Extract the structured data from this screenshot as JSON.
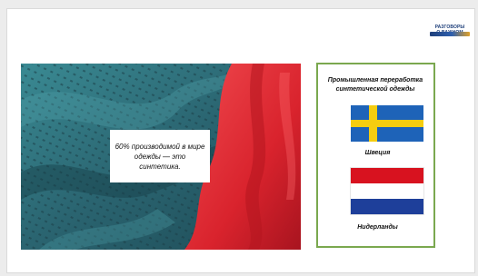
{
  "logo": {
    "text": "РАЗГОВОРЫ\nО ВАЖНОМ"
  },
  "photo": {
    "caption": "60% производимой в мире одежды — это синтетика."
  },
  "panel": {
    "title": "Промышленная переработка синтетической одежды",
    "countries": [
      {
        "name": "Швеция",
        "flag": "sweden-flag"
      },
      {
        "name": "Нидерланды",
        "flag": "netherlands-flag"
      }
    ]
  },
  "colors": {
    "panel_border": "#7aa84f",
    "fabric_teal": "#2f6f7a",
    "fabric_red": "#e4323a"
  }
}
